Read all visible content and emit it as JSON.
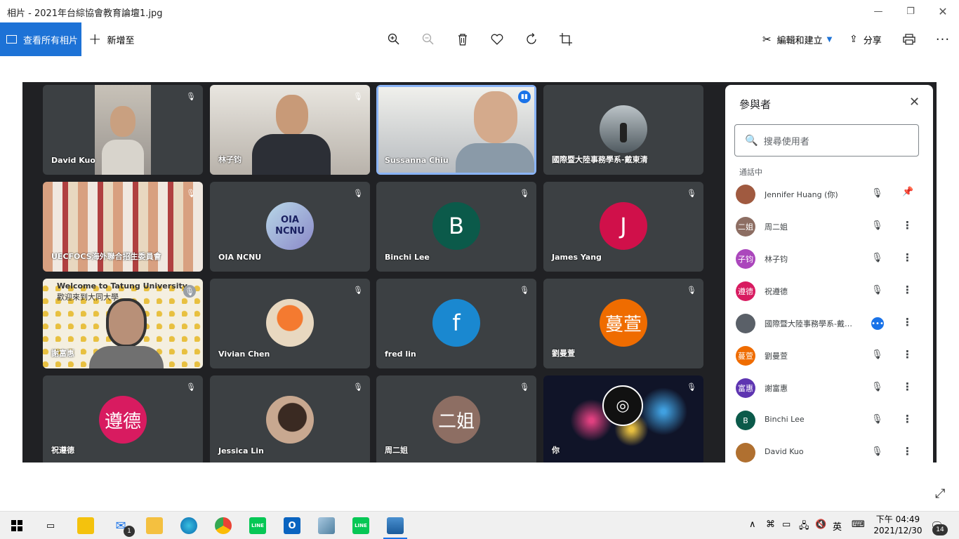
{
  "window": {
    "title": "相片 - 2021年台綜協會教育論壇1.jpg",
    "minimize_icon": "minimize-icon",
    "maximize_icon": "restore-icon",
    "close_icon": "close-icon"
  },
  "toolbar": {
    "view_all_label": "查看所有相片",
    "add_to_label": "新增至",
    "edit_label": "編輯和建立",
    "share_label": "分享",
    "icons": [
      "zoom-in-icon",
      "zoom-out-icon",
      "delete-icon",
      "favorite-icon",
      "rotate-icon",
      "crop-icon",
      "print-icon",
      "more-icon"
    ]
  },
  "meeting": {
    "tiles": [
      {
        "name": "David Kuo",
        "type": "video",
        "bg": "#6b6e70"
      },
      {
        "name": "林子钧",
        "type": "video",
        "bg": "#6a6560"
      },
      {
        "name": "Sussanna Chiu",
        "type": "video",
        "bg": "#7b838a",
        "speaking": true
      },
      {
        "name": "國際暨大陸事務學系-戴東清",
        "type": "photo-avatar",
        "bg": "#4a5058"
      },
      {
        "name": "UECFOCS海外聯合招生委員會",
        "type": "video",
        "bg": "#7a5a4a"
      },
      {
        "name": "OIA NCNU",
        "type": "text-avatar",
        "initial": "OIA NCNU",
        "color": "#9fb5d6"
      },
      {
        "name": "Binchi Lee",
        "type": "letter-avatar",
        "initial": "B",
        "color": "#0b5a4a"
      },
      {
        "name": "James Yang",
        "type": "letter-avatar",
        "initial": "J",
        "color": "#d0104a"
      },
      {
        "name": "謝富惠",
        "type": "video",
        "bg": "#d9cfa0",
        "overlay_title": "Welcome to Tatung University",
        "overlay_sub": "歡迎來到大同大學"
      },
      {
        "name": "Vivian Chen",
        "type": "photo-avatar",
        "bg": "#e8774a"
      },
      {
        "name": "fred lin",
        "type": "letter-avatar",
        "initial": "f",
        "color": "#1a88d0"
      },
      {
        "name": "劉曼萱",
        "type": "letter-avatar",
        "initial": "蔓萱",
        "color": "#ef6c00"
      },
      {
        "name": "祝遵德",
        "type": "letter-avatar",
        "initial": "遵德",
        "color": "#d81b60"
      },
      {
        "name": "Jessica Lin",
        "type": "photo-avatar",
        "bg": "#8a6a58"
      },
      {
        "name": "周二姐",
        "type": "letter-avatar",
        "initial": "二姐",
        "color": "#8d6e63"
      },
      {
        "name": "你",
        "type": "video",
        "bg": "#1a1f3a"
      }
    ],
    "panel": {
      "title": "參與者",
      "search_placeholder": "搜尋使用者",
      "section": "通話中",
      "participants": [
        {
          "name": "Jennifer Huang (你)",
          "initial": "",
          "color": "#a05a40",
          "action": "pin-icon"
        },
        {
          "name": "周二姐",
          "initial": "二姐",
          "color": "#8d6e63",
          "action": "more-vert-icon"
        },
        {
          "name": "林子钧",
          "initial": "子钧",
          "color": "#ab47bc",
          "action": "more-vert-icon"
        },
        {
          "name": "祝遵德",
          "initial": "遵德",
          "color": "#d81b60",
          "action": "more-vert-icon"
        },
        {
          "name": "國際暨大陸事務學系-戴東清",
          "initial": "",
          "color": "#5a6068",
          "action": "more-vert-icon"
        },
        {
          "name": "劉曼萱",
          "initial": "蔓萱",
          "color": "#ef6c00",
          "action": "more-vert-icon"
        },
        {
          "name": "謝富惠",
          "initial": "富惠",
          "color": "#5e35b1",
          "action": "more-vert-icon"
        },
        {
          "name": "Binchi Lee",
          "initial": "B",
          "color": "#0b5a4a",
          "action": "more-vert-icon"
        },
        {
          "name": "David Kuo",
          "initial": "",
          "color": "#b07030",
          "action": "more-vert-icon"
        }
      ]
    }
  },
  "taskbar": {
    "mail_badge": "1",
    "ime": "英",
    "clock_period_time": "下午 04:49",
    "date": "2021/12/30",
    "notifications": "14"
  }
}
